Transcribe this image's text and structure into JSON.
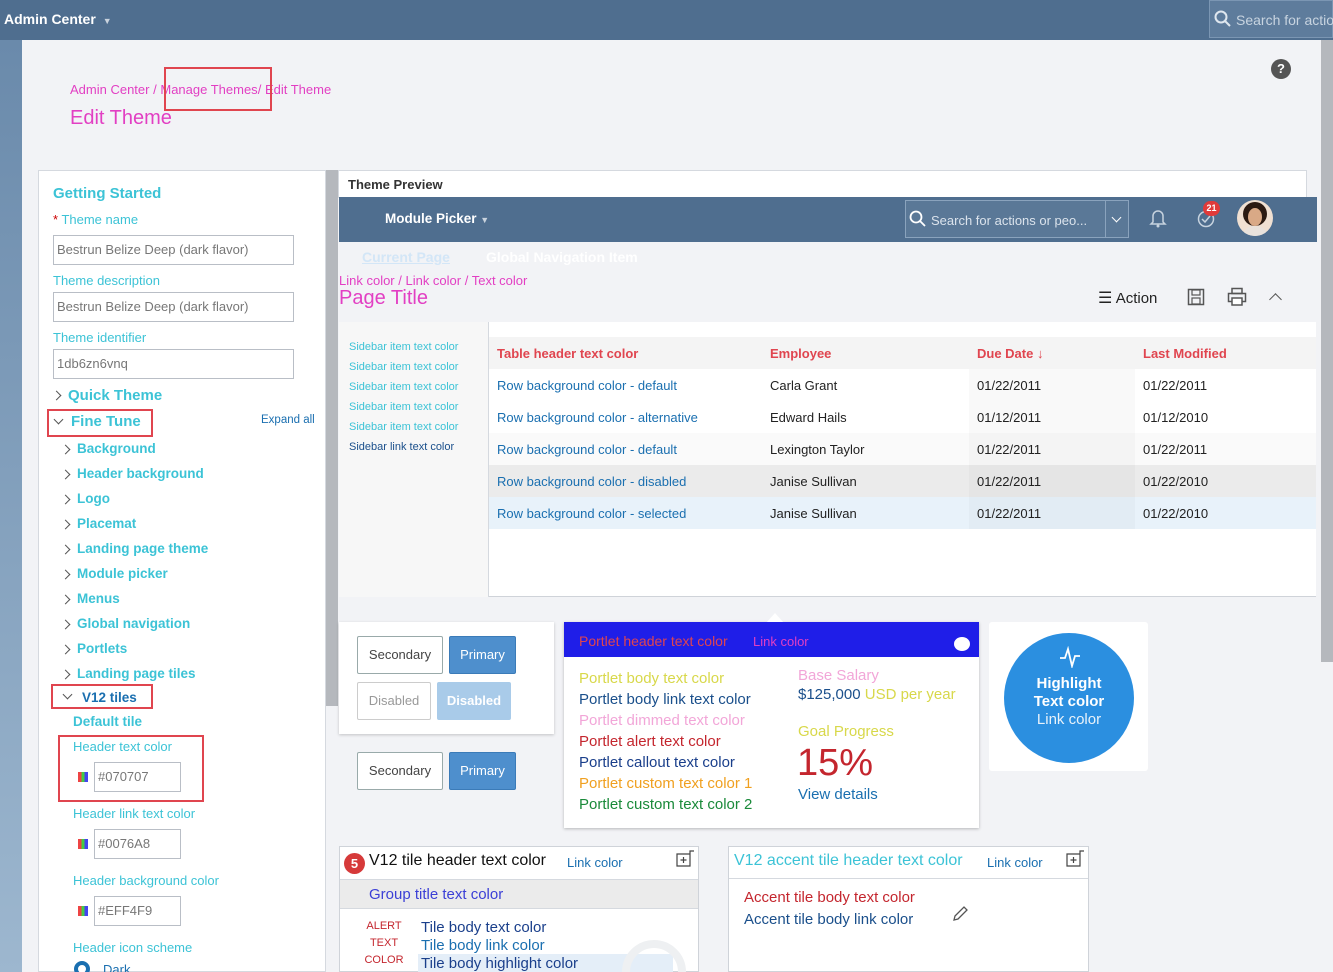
{
  "topbar": {
    "title": "Admin Center",
    "search_placeholder": "Search for actio"
  },
  "breadcrumb": {
    "item1": "Admin Center",
    "sep": "/",
    "item2": "Manage Themes",
    "item3": "Edit Theme"
  },
  "page_title": "Edit Theme",
  "help_label": "?",
  "left_panel": {
    "getting_started": "Getting Started",
    "required_mark": "*",
    "theme_name_label": "Theme name",
    "theme_name_value": "Bestrun Belize Deep (dark flavor)",
    "theme_desc_label": "Theme description",
    "theme_desc_value": "Bestrun Belize Deep (dark flavor)",
    "theme_id_label": "Theme identifier",
    "theme_id_value": "1db6zn6vnq",
    "quick_theme": "Quick Theme",
    "fine_tune": "Fine Tune",
    "expand_all": "Expand all",
    "items": [
      "Background",
      "Header background",
      "Logo",
      "Placemat",
      "Landing page theme",
      "Module picker",
      "Menus",
      "Global navigation",
      "Portlets",
      "Landing page tiles"
    ],
    "v12_tiles": "V12 tiles",
    "default_tile": "Default tile",
    "header_text_color_label": "Header text color",
    "header_text_color_value": "#070707",
    "header_link_text_color_label": "Header link text color",
    "header_link_text_color_value": "#0076A8",
    "header_bg_color_label": "Header background color",
    "header_bg_color_value": "#EFF4F9",
    "header_icon_scheme_label": "Header icon scheme",
    "icon_scheme_option": "Dark"
  },
  "preview": {
    "title": "Theme Preview",
    "module_picker": "Module Picker",
    "search_placeholder": "Search for actions or peo...",
    "notif_count": "21",
    "current_page": "Current Page",
    "global_nav_item": "Global Navigation Item",
    "crumb": "Link color / Link color / Text color",
    "page_title": "Page Title",
    "action_label": "Action",
    "sidebar_items": [
      "Sidebar item text color",
      "Sidebar item text color",
      "Sidebar item text color",
      "Sidebar item text color",
      "Sidebar item text color",
      "Sidebar link text color"
    ],
    "table": {
      "headers": [
        "Table header text color",
        "Employee",
        "Due Date",
        "Last Modified"
      ],
      "rows": [
        [
          "Row background color - default",
          "Carla Grant",
          "01/22/2011",
          "01/22/2011"
        ],
        [
          "Row background color - alternative",
          "Edward Hails",
          "01/12/2011",
          "01/12/2010"
        ],
        [
          "Row background color - default",
          "Lexington Taylor",
          "01/22/2011",
          "01/22/2011"
        ],
        [
          "Row background color - disabled",
          "Janise Sullivan",
          "01/22/2011",
          "01/22/2010"
        ],
        [
          "Row background color - selected",
          "Janise Sullivan",
          "01/22/2011",
          "01/22/2010"
        ]
      ]
    },
    "buttons": {
      "secondary": "Secondary",
      "primary": "Primary",
      "disabled": "Disabled"
    },
    "portlet": {
      "header_text": "Portlet header text color",
      "header_link": "Link color",
      "body_text": "Portlet body text color",
      "body_link": "Portlet body link text color",
      "dimmed": "Portlet dimmed text color",
      "alert": "Portlet alert text color",
      "callout": "Portlet callout text color",
      "custom1": "Portlet custom text color 1",
      "custom2": "Portlet custom text color 2",
      "base_salary_label": "Base Salary",
      "base_salary_value": "$125,000",
      "base_salary_unit": "USD per year",
      "goal_label": "Goal Progress",
      "goal_value": "15%",
      "view_details": "View details"
    },
    "highlight": {
      "line1": "Highlight",
      "line2": "Text color",
      "line3": "Link color"
    },
    "v12_tile": {
      "badge": "5",
      "header": "V12 tile header text color",
      "link": "Link color",
      "group_title": "Group title text color",
      "alert1": "ALERT",
      "alert2": "TEXT",
      "alert3": "COLOR",
      "body_text": "Tile body text color",
      "body_link": "Tile body link color",
      "body_highlight": "Tile body highlight color"
    },
    "accent_tile": {
      "header": "V12 accent tile header text color",
      "link": "Link color",
      "body_text": "Accent tile body text color",
      "body_link": "Accent tile body link color"
    }
  }
}
